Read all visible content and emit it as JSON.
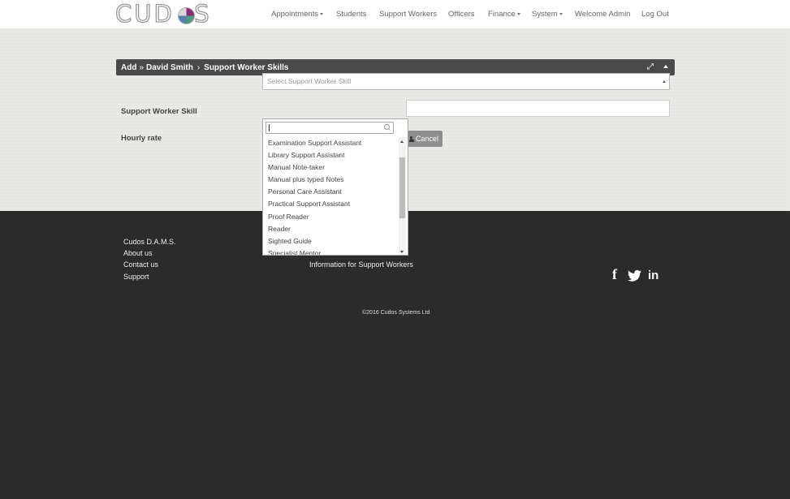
{
  "logo": {
    "text": "CUD S"
  },
  "nav": {
    "appointments": "Appointments",
    "students": "Students",
    "support_workers": "Support Workers",
    "officers": "Officers",
    "finance": "Finance",
    "system": "System",
    "welcome": "Welcome Admin",
    "logout": "Log Out"
  },
  "breadcrumb": {
    "add": "Add",
    "sep1": "»",
    "person": "David Smith",
    "sep2": "›",
    "section": "Support Worker Skills"
  },
  "form": {
    "skill_label": "Support Worker Skill",
    "skill_placeholder": "Select Support Worker Skill",
    "rate_label": "Hourly rate",
    "rate_value": "",
    "cancel_label": "Cancel"
  },
  "dropdown": {
    "search_value": "",
    "items": [
      "Examination Support Assistant",
      "Library Support Assistant",
      "Manual Note-taker",
      "Manual plus typed Notes",
      "Personal Care Assistant",
      "Practical Support Assistant",
      "Proof Reader",
      "Reader",
      "Sighted Guide",
      "Specialist Mentor"
    ]
  },
  "footer": {
    "col1": [
      "Cudos D.A.M.S.",
      "About us",
      "Contact us",
      "Support"
    ],
    "col2": [
      "Information for Support Workers"
    ],
    "copyright": "©2016 Cudos Systems Ltd",
    "social_icons": [
      "facebook-icon",
      "twitter-icon",
      "linkedin-icon"
    ]
  },
  "colors": {
    "header_bg": "#4a4a4a",
    "footer_bg": "#2b2b2b",
    "content_bg": "#e9e9e6",
    "button_bg": "#8f8f8f"
  }
}
